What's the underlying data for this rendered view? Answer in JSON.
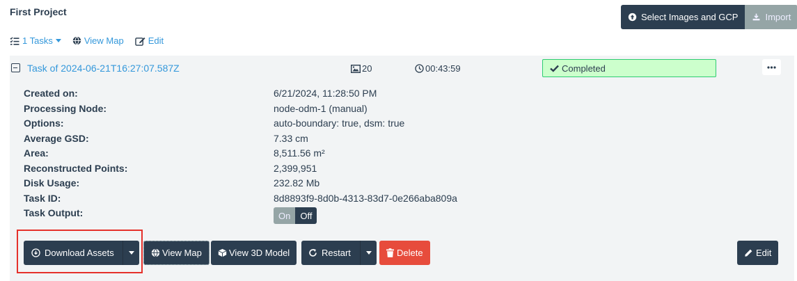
{
  "project": {
    "title": "First Project"
  },
  "top_actions": {
    "select_label": "Select Images and GCP",
    "import_label": "Import"
  },
  "toolbar": {
    "tasks_label": "1 Tasks",
    "view_map_label": "View Map",
    "edit_label": "Edit"
  },
  "task": {
    "name": "Task of 2024-06-21T16:27:07.587Z",
    "image_count": "20",
    "duration": "00:43:59",
    "status": "Completed",
    "details": [
      {
        "label": "Created on:",
        "value": "6/21/2024, 11:28:50 PM"
      },
      {
        "label": "Processing Node:",
        "value": "node-odm-1 (manual)"
      },
      {
        "label": "Options:",
        "value": "auto-boundary: true, dsm: true"
      },
      {
        "label": "Average GSD:",
        "value": "7.33 cm"
      },
      {
        "label": "Area:",
        "value": "8,511.56 m²"
      },
      {
        "label": "Reconstructed Points:",
        "value": "2,399,951"
      },
      {
        "label": "Disk Usage:",
        "value": "232.82 Mb"
      },
      {
        "label": "Task ID:",
        "value": "8d8893f9-8d0b-4313-83d7-0e266aba809a"
      }
    ],
    "task_output_label": "Task Output:",
    "toggle": {
      "on": "On",
      "off": "Off",
      "selected": "Off"
    }
  },
  "actions": {
    "download_assets": "Download Assets",
    "view_map": "View Map",
    "view_3d": "View 3D Model",
    "restart": "Restart",
    "delete": "Delete",
    "edit": "Edit"
  },
  "colors": {
    "primary": "#2c3e50",
    "link": "#3498db",
    "status_bg": "#ccffcc",
    "status_border": "#2ecc71",
    "danger": "#e74c3c",
    "muted": "#95a5a6",
    "highlight": "#e5312b"
  }
}
